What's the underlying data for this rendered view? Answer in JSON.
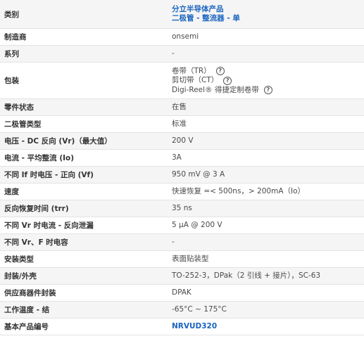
{
  "rows": [
    {
      "label": "类别",
      "values": [
        "分立半导体产品",
        "二极管 - 整流器 - 单"
      ],
      "link": true
    },
    {
      "label": "制造商",
      "values": [
        "onsemi"
      ]
    },
    {
      "label": "系列",
      "values": [
        "-"
      ]
    },
    {
      "label": "包装",
      "values": [
        "卷带（TR）",
        "剪切带（CT）",
        "Digi-Reel® 得捷定制卷带"
      ],
      "help": true
    },
    {
      "label": "零件状态",
      "values": [
        "在售"
      ]
    },
    {
      "label": "二极管类型",
      "values": [
        "标准"
      ]
    },
    {
      "label": "电压 - DC 反向 (Vr)（最大值）",
      "values": [
        "200 V"
      ]
    },
    {
      "label": "电流 - 平均整流 (Io)",
      "values": [
        "3A"
      ]
    },
    {
      "label": "不同 If 时电压 - 正向 (Vf)",
      "values": [
        "950 mV @ 3 A"
      ]
    },
    {
      "label": "速度",
      "values": [
        "快速恢复 =< 500ns，> 200mA（Io）"
      ]
    },
    {
      "label": "反向恢复时间 (trr)",
      "values": [
        "35 ns"
      ]
    },
    {
      "label": "不同 Vr 时电流 - 反向泄漏",
      "values": [
        "5 µA @ 200 V"
      ]
    },
    {
      "label": "不同 Vr、F 时电容",
      "values": [
        "-"
      ]
    },
    {
      "label": "安装类型",
      "values": [
        "表面贴装型"
      ]
    },
    {
      "label": "封装/外壳",
      "values": [
        "TO-252-3，DPak（2 引线 + 接片），SC-63"
      ]
    },
    {
      "label": "供应商器件封装",
      "values": [
        "DPAK"
      ]
    },
    {
      "label": "工作温度 - 结",
      "values": [
        "-65°C ~ 175°C"
      ]
    },
    {
      "label": "基本产品编号",
      "values": [
        "NRVUD320"
      ],
      "link": true
    }
  ],
  "help_symbol": "?"
}
